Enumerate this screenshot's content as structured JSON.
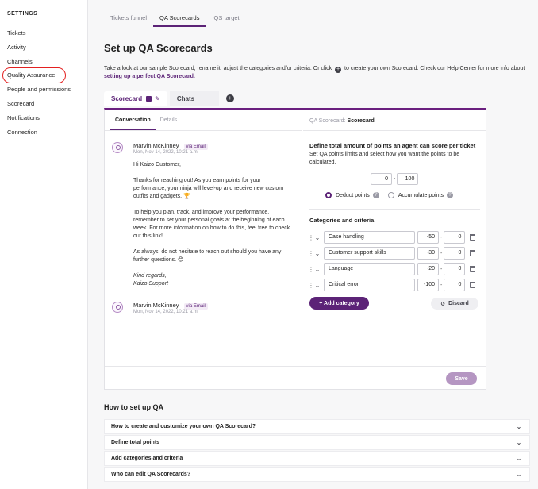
{
  "sidebar": {
    "heading": "SETTINGS",
    "items": [
      {
        "label": "Tickets"
      },
      {
        "label": "Activity"
      },
      {
        "label": "Channels"
      },
      {
        "label": "Quality Assurance"
      },
      {
        "label": "People and permissions"
      },
      {
        "label": "Scorecard"
      },
      {
        "label": "Notifications"
      },
      {
        "label": "Connection"
      }
    ],
    "active_index": 3
  },
  "top_tabs": [
    {
      "label": "Tickets funnel"
    },
    {
      "label": "QA Scorecards"
    },
    {
      "label": "IQS target"
    }
  ],
  "page": {
    "title": "Set up QA Scorecards",
    "intro_before": "Take a look at our sample Scorecard, rename it, adjust the categories and/or criteria. Or click",
    "intro_after": "to create your own Scorecard. Check our Help Center for more info about",
    "intro_link": "setting up a perfect QA Scorecard."
  },
  "scorecard_tabs": [
    {
      "label": "Scorecard"
    },
    {
      "label": "Chats"
    }
  ],
  "conversation": {
    "tabs": [
      {
        "label": "Conversation"
      },
      {
        "label": "Details"
      }
    ],
    "messages": [
      {
        "sender": "Marvin McKinney",
        "via": "via Email",
        "date": "Mon, Nov 14, 2022, 10:21 a.m."
      },
      {
        "sender": "Marvin McKinney",
        "via": "via Email",
        "date": "Mon, Nov 14, 2022, 10:21 a.m."
      }
    ],
    "body": {
      "greeting": "Hi Kaizo Customer,",
      "p1": "Thanks for reaching out! As you earn points for your performance, your ninja will level-up and receive new custom outfits and gadgets. 🏆",
      "p2": "To help you plan, track, and improve your performance, remember to set your personal goals at the beginning of each week. For more information on how to do this, feel free to check out this link!",
      "p3": "As always, do not hesitate to reach out should you have any further questions. 😊",
      "sign1": "Kind regards,",
      "sign2": "Kaizo Support"
    }
  },
  "scorecard_panel": {
    "header_label": "QA Scorecard:",
    "header_value": "Scorecard",
    "points_title": "Define total amount of points an agent can score per ticket",
    "points_desc": "Set QA points limits and select how you want the points to be calculated.",
    "limit_min": "0",
    "limit_max": "100",
    "deduct_label": "Deduct points",
    "accumulate_label": "Accumulate points",
    "categories_title": "Categories and criteria",
    "criteria": [
      {
        "name": "Case handling",
        "min": "-50",
        "max": "0"
      },
      {
        "name": "Customer support skills",
        "min": "-30",
        "max": "0"
      },
      {
        "name": "Language",
        "min": "-20",
        "max": "0"
      },
      {
        "name": "Critical error",
        "min": "-100",
        "max": "0"
      }
    ],
    "add_category_label": "+ Add category",
    "discard_label": "Discard",
    "save_label": "Save"
  },
  "howto": {
    "title": "How to set up QA",
    "items": [
      {
        "label": "How to create and customize your own QA Scorecard?"
      },
      {
        "label": "Define total points"
      },
      {
        "label": "Add categories and criteria"
      },
      {
        "label": "Who can edit QA Scorecards?"
      }
    ]
  },
  "colors": {
    "accent": "#5c2377",
    "highlight_ring": "#e32020",
    "save_disabled": "#b596c2"
  }
}
